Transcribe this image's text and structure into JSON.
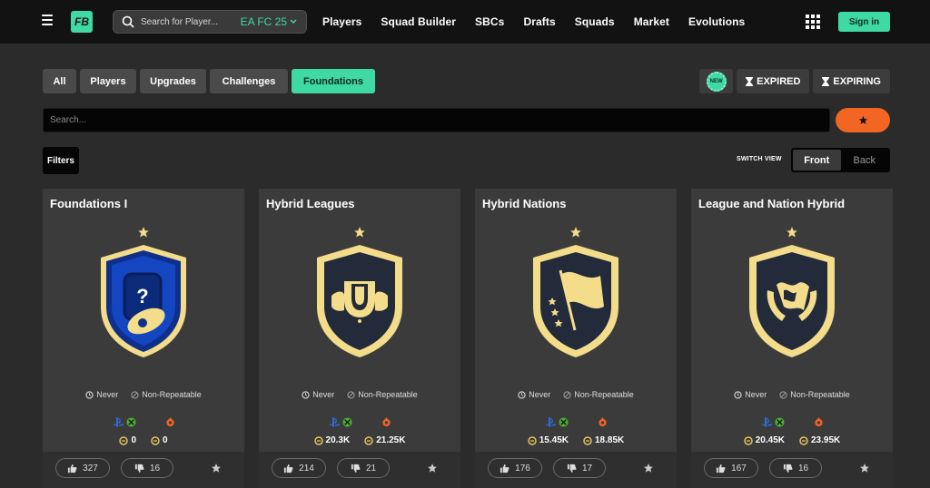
{
  "nav": {
    "logo_text": "FB",
    "search_placeholder": "Search for Player...",
    "game_version": "EA FC 25",
    "links": [
      "Players",
      "Squad Builder",
      "SBCs",
      "Drafts",
      "Squads",
      "Market",
      "Evolutions"
    ],
    "signin_label": "Sign in",
    "accent_color": "#3fd9a4"
  },
  "tabs": [
    {
      "label": "All",
      "active": false
    },
    {
      "label": "Players",
      "active": false
    },
    {
      "label": "Upgrades",
      "active": false
    },
    {
      "label": "Challenges",
      "active": false
    },
    {
      "label": "Foundations",
      "active": true
    }
  ],
  "right_buttons": {
    "new_badge": "NEW",
    "expired_label": "EXPIRED",
    "expiring_label": "EXPIRING"
  },
  "search": {
    "placeholder": "Search..."
  },
  "filters_label": "Filters",
  "view_switch": {
    "label": "SWITCH VIEW",
    "front": "Front",
    "back": "Back",
    "selected": "Front"
  },
  "cards": [
    {
      "title": "Foundations I",
      "badge": "blue-whistle-badge",
      "expiry": "Never",
      "repeat": "Non-Repeatable",
      "console_price": "0",
      "pc_price": "0",
      "likes": "327",
      "dislikes": "16"
    },
    {
      "title": "Hybrid Leagues",
      "badge": "gold-trophy-badge",
      "expiry": "Never",
      "repeat": "Non-Repeatable",
      "console_price": "20.3K",
      "pc_price": "21.25K",
      "likes": "214",
      "dislikes": "21"
    },
    {
      "title": "Hybrid Nations",
      "badge": "gold-flag-badge",
      "expiry": "Never",
      "repeat": "Non-Repeatable",
      "console_price": "15.45K",
      "pc_price": "18.85K",
      "likes": "176",
      "dislikes": "17"
    },
    {
      "title": "League and Nation Hybrid",
      "badge": "gold-flag-laurel-badge",
      "expiry": "Never",
      "repeat": "Non-Repeatable",
      "console_price": "20.45K",
      "pc_price": "23.95K",
      "likes": "167",
      "dislikes": "16"
    }
  ]
}
